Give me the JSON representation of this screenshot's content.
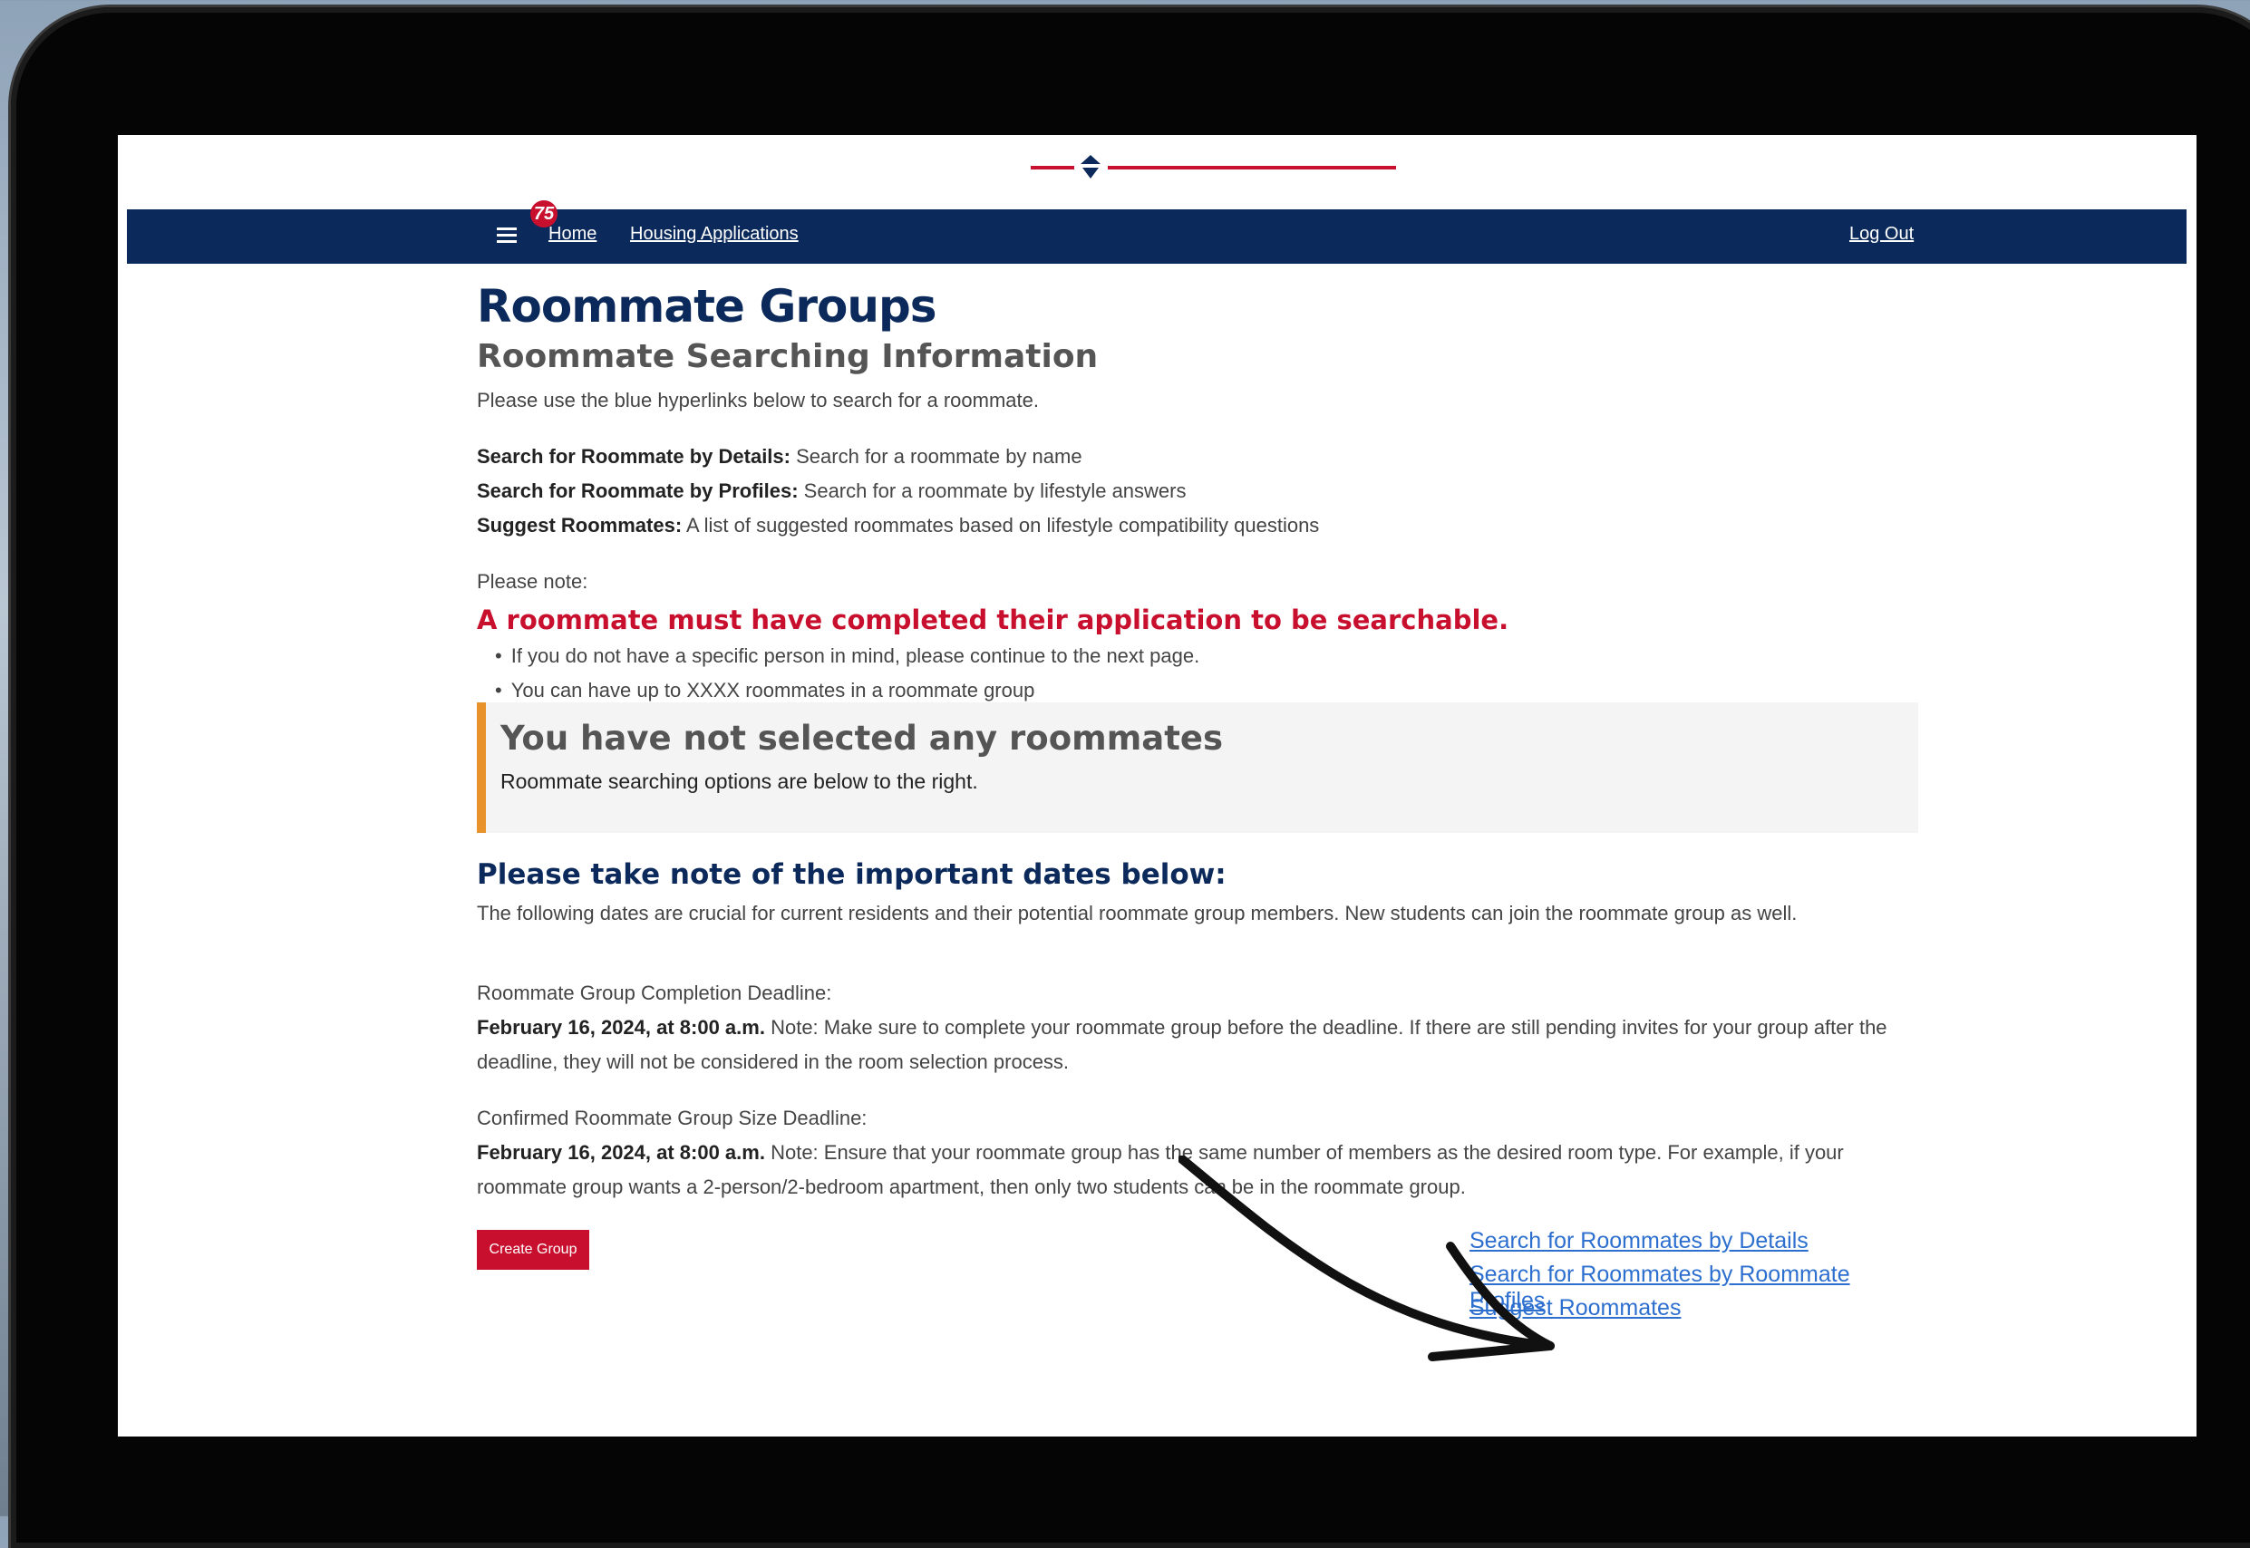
{
  "logo": {
    "badge": "75"
  },
  "nav": {
    "home": "Home",
    "housing_applications": "Housing Applications",
    "logout": "Log Out"
  },
  "page": {
    "title": "Roommate Groups",
    "subtitle": "Roommate Searching Information",
    "intro": "Please use the blue hyperlinks below to search for a roommate.",
    "definitions": [
      {
        "term": "Search for Roommate by Details:",
        "desc": " Search for a roommate by name"
      },
      {
        "term": "Search for Roommate by Profiles:",
        "desc": " Search for a roommate by lifestyle answers"
      },
      {
        "term": "Suggest Roommates:",
        "desc": " A list of suggested roommates based on lifestyle compatibility questions"
      }
    ],
    "please_note": "Please note:",
    "warning_heading": "A roommate must have completed their application to be searchable.",
    "bullets": [
      "If you do not have a specific person in mind, please continue to the next page.",
      "You can have up to XXXX roommates in a roommate group"
    ],
    "notice": {
      "title": "You have not selected any roommates",
      "text": "Roommate searching options are below to the right."
    },
    "dates_heading": "Please take note of the important dates below:",
    "dates_intro": "The following dates are crucial for current residents and their potential roommate group members. New students can join the roommate group as well.",
    "deadlines": [
      {
        "label": "Roommate Group Completion Deadline:",
        "date": "February 16, 2024, at 8:00 a.m.",
        "note": " Note: Make sure to complete your roommate group before the deadline. If there are still pending invites for your group after the deadline, they will not be considered in the room selection process."
      },
      {
        "label": "Confirmed Roommate Group Size Deadline:",
        "date": "February 16, 2024, at 8:00 a.m.",
        "note": " Note: Ensure that your roommate group has the same number of members as the desired room type. For example, if your roommate group wants a 2-person/2-bedroom apartment, then only two students can be in the roommate group."
      }
    ],
    "create_group": "Create Group",
    "links": {
      "details": "Search for Roommates by Details",
      "profiles": "Search for Roommates by Roommate Profiles",
      "suggest": "Suggest Roommates"
    }
  },
  "colors": {
    "navy": "#0b2a5b",
    "red": "#c8102e",
    "link_blue": "#2d6fcf",
    "notice_accent": "#e8922b"
  }
}
